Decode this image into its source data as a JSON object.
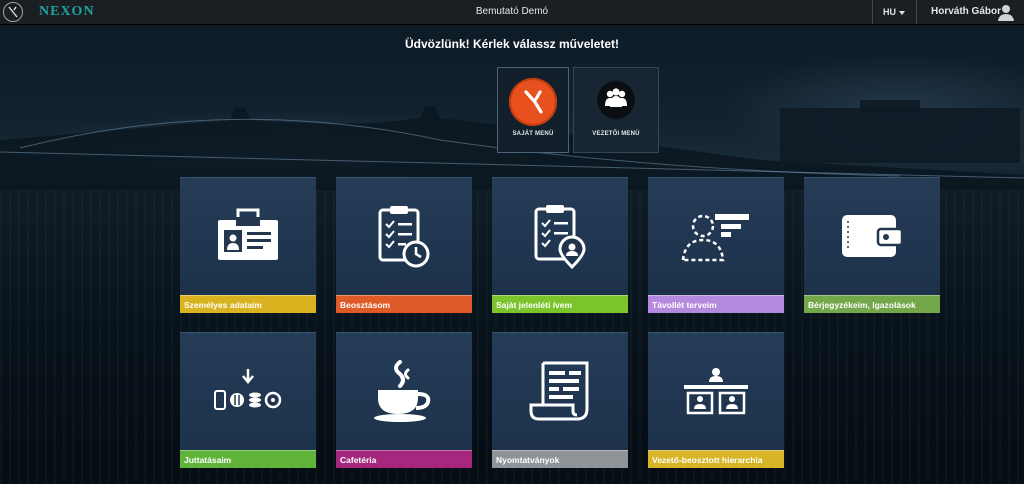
{
  "topbar": {
    "brand": "NEXON",
    "env_title": "Bemutató Demó",
    "language": "HU",
    "user_name": "Horváth Gábor",
    "icons": [
      "nexon-logo-icon",
      "user-avatar-icon",
      "caret-down-icon"
    ]
  },
  "welcome": "Üdvözlünk! Kérlek válassz műveletet!",
  "menu_switch": [
    {
      "label": "SAJÁT MENÜ",
      "icon": "nexon-logo-icon",
      "color": "#e8501d"
    },
    {
      "label": "VEZETŐI MENÜ",
      "icon": "group-icon",
      "color": "#0c0f12"
    }
  ],
  "tiles": [
    {
      "label": "Személyes adataim",
      "icon": "id-badge-icon",
      "color": "#d9b21f"
    },
    {
      "label": "Beosztásom",
      "icon": "clipboard-clock-icon",
      "color": "#de5a26"
    },
    {
      "label": "Saját jelenléti ívem",
      "icon": "clipboard-user-icon",
      "color": "#7bc42b"
    },
    {
      "label": "Távollét terveim",
      "icon": "absence-user-icon",
      "color": "#b48ade"
    },
    {
      "label": "Bérjegyzékeim, Igazolások",
      "icon": "wallet-icon",
      "color": "#74a64a"
    },
    {
      "label": "Juttatásaim",
      "icon": "benefits-icon",
      "color": "#5fb439"
    },
    {
      "label": "Cafetéria",
      "icon": "coffee-cup-icon",
      "color": "#a6287e"
    },
    {
      "label": "Nyomtatványok",
      "icon": "document-scroll-icon",
      "color": "#8e9497"
    },
    {
      "label": "Vezető-beosztott hierarchia",
      "icon": "hierarchy-icon",
      "color": "#d8b527"
    }
  ]
}
